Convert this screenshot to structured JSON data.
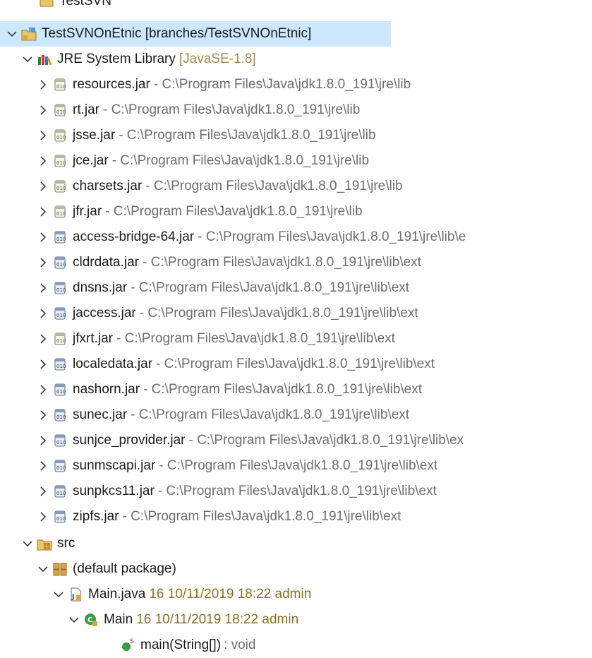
{
  "tree": {
    "rows": [
      {
        "id": "r0",
        "label": "TestSVN",
        "decoration": "",
        "icon": "folder-icon",
        "twisty": "none",
        "depth": 0
      },
      {
        "id": "r1",
        "label": "TestSVNOnEtnic [branches/TestSVNOnEtnic]",
        "decoration": "",
        "icon": "svn-project-icon",
        "twisty": "expanded",
        "depth": 0,
        "selected": true
      },
      {
        "id": "r2",
        "label": "JRE System Library",
        "decoration": "[JavaSE-1.8]",
        "icon": "library-icon",
        "twisty": "expanded",
        "depth": 1
      },
      {
        "id": "r3",
        "label": "resources.jar",
        "decoration": "- C:\\Program Files\\Java\\jdk1.8.0_191\\jre\\lib",
        "icon": "jar-src-icon",
        "twisty": "collapsed",
        "depth": 2
      },
      {
        "id": "r4",
        "label": "rt.jar",
        "decoration": "- C:\\Program Files\\Java\\jdk1.8.0_191\\jre\\lib",
        "icon": "jar-src-icon",
        "twisty": "collapsed",
        "depth": 2
      },
      {
        "id": "r5",
        "label": "jsse.jar",
        "decoration": "- C:\\Program Files\\Java\\jdk1.8.0_191\\jre\\lib",
        "icon": "jar-src-icon",
        "twisty": "collapsed",
        "depth": 2
      },
      {
        "id": "r6",
        "label": "jce.jar",
        "decoration": "- C:\\Program Files\\Java\\jdk1.8.0_191\\jre\\lib",
        "icon": "jar-src-icon",
        "twisty": "collapsed",
        "depth": 2
      },
      {
        "id": "r7",
        "label": "charsets.jar",
        "decoration": "- C:\\Program Files\\Java\\jdk1.8.0_191\\jre\\lib",
        "icon": "jar-src-icon",
        "twisty": "collapsed",
        "depth": 2
      },
      {
        "id": "r8",
        "label": "jfr.jar",
        "decoration": "- C:\\Program Files\\Java\\jdk1.8.0_191\\jre\\lib",
        "icon": "jar-src-icon",
        "twisty": "collapsed",
        "depth": 2
      },
      {
        "id": "r9",
        "label": "access-bridge-64.jar",
        "decoration": "- C:\\Program Files\\Java\\jdk1.8.0_191\\jre\\lib\\e",
        "icon": "jar-icon",
        "twisty": "collapsed",
        "depth": 2
      },
      {
        "id": "r10",
        "label": "cldrdata.jar",
        "decoration": "- C:\\Program Files\\Java\\jdk1.8.0_191\\jre\\lib\\ext",
        "icon": "jar-icon",
        "twisty": "collapsed",
        "depth": 2
      },
      {
        "id": "r11",
        "label": "dnsns.jar",
        "decoration": "- C:\\Program Files\\Java\\jdk1.8.0_191\\jre\\lib\\ext",
        "icon": "jar-icon",
        "twisty": "collapsed",
        "depth": 2
      },
      {
        "id": "r12",
        "label": "jaccess.jar",
        "decoration": "- C:\\Program Files\\Java\\jdk1.8.0_191\\jre\\lib\\ext",
        "icon": "jar-icon",
        "twisty": "collapsed",
        "depth": 2
      },
      {
        "id": "r13",
        "label": "jfxrt.jar",
        "decoration": "- C:\\Program Files\\Java\\jdk1.8.0_191\\jre\\lib\\ext",
        "icon": "jar-src-icon",
        "twisty": "collapsed",
        "depth": 2
      },
      {
        "id": "r14",
        "label": "localedata.jar",
        "decoration": "- C:\\Program Files\\Java\\jdk1.8.0_191\\jre\\lib\\ext",
        "icon": "jar-icon",
        "twisty": "collapsed",
        "depth": 2
      },
      {
        "id": "r15",
        "label": "nashorn.jar",
        "decoration": "- C:\\Program Files\\Java\\jdk1.8.0_191\\jre\\lib\\ext",
        "icon": "jar-icon",
        "twisty": "collapsed",
        "depth": 2
      },
      {
        "id": "r16",
        "label": "sunec.jar",
        "decoration": "- C:\\Program Files\\Java\\jdk1.8.0_191\\jre\\lib\\ext",
        "icon": "jar-icon",
        "twisty": "collapsed",
        "depth": 2
      },
      {
        "id": "r17",
        "label": "sunjce_provider.jar",
        "decoration": "- C:\\Program Files\\Java\\jdk1.8.0_191\\jre\\lib\\ex",
        "icon": "jar-icon",
        "twisty": "collapsed",
        "depth": 2
      },
      {
        "id": "r18",
        "label": "sunmscapi.jar",
        "decoration": "- C:\\Program Files\\Java\\jdk1.8.0_191\\jre\\lib\\ext",
        "icon": "jar-icon",
        "twisty": "collapsed",
        "depth": 2
      },
      {
        "id": "r19",
        "label": "sunpkcs11.jar",
        "decoration": "- C:\\Program Files\\Java\\jdk1.8.0_191\\jre\\lib\\ext",
        "icon": "jar-icon",
        "twisty": "collapsed",
        "depth": 2
      },
      {
        "id": "r20",
        "label": "zipfs.jar",
        "decoration": "- C:\\Program Files\\Java\\jdk1.8.0_191\\jre\\lib\\ext",
        "icon": "jar-icon",
        "twisty": "collapsed",
        "depth": 2
      },
      {
        "id": "r21",
        "label": "src",
        "decoration": "",
        "icon": "source-folder-icon",
        "twisty": "expanded",
        "depth": 1
      },
      {
        "id": "r22",
        "label": "(default package)",
        "decoration": "",
        "icon": "package-icon",
        "twisty": "expanded",
        "depth": 2
      },
      {
        "id": "r23",
        "label": "Main.java",
        "decoration": "16  10/11/2019 18:22  admin",
        "icon": "java-file-icon",
        "twisty": "expanded",
        "depth": 3
      },
      {
        "id": "r24",
        "label": "Main",
        "decoration": "16  10/11/2019 18:22  admin",
        "icon": "class-icon",
        "twisty": "expanded",
        "depth": 4
      },
      {
        "id": "r25",
        "label": "main(String[])",
        "decoration": ": void",
        "icon": "static-method-icon",
        "twisty": "none",
        "depth": 5
      }
    ]
  },
  "colors": {
    "selection": "#cce8ff",
    "decoration": "#6d6d6d",
    "svn_decoration": "#8a6d2a",
    "twisty": "#3c3c3c"
  }
}
